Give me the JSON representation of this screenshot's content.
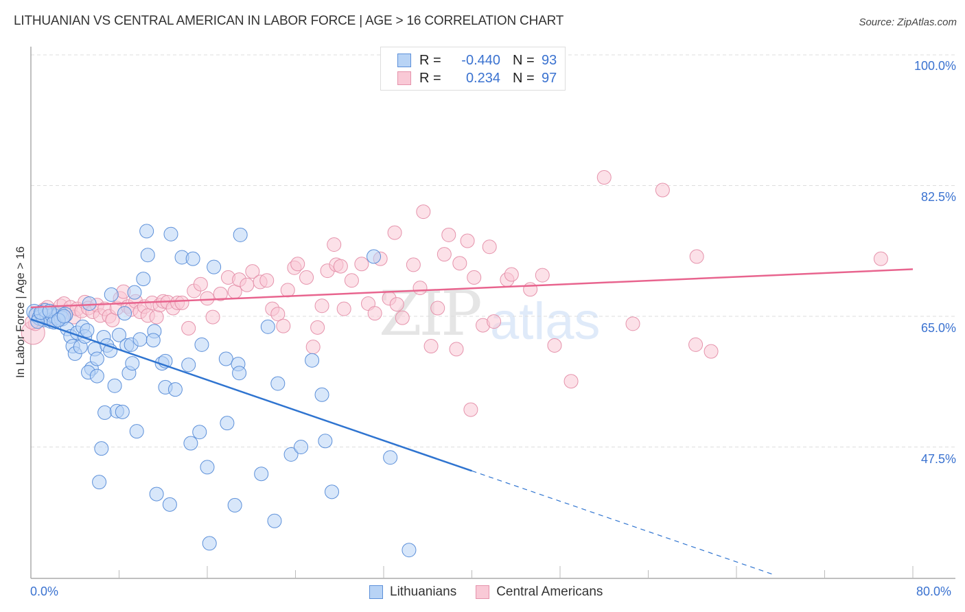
{
  "title": "LITHUANIAN VS CENTRAL AMERICAN IN LABOR FORCE | AGE > 16 CORRELATION CHART",
  "source": "Source: ZipAtlas.com",
  "watermark": {
    "zip": "ZIP",
    "atlas": "atlas"
  },
  "legend_top": {
    "rows": [
      {
        "r_label": "R =",
        "r_value": "-0.440",
        "n_label": "N =",
        "n_value": "93"
      },
      {
        "r_label": "R =",
        "r_value": "0.234",
        "n_label": "N =",
        "n_value": "97"
      }
    ]
  },
  "colors": {
    "blue_fill": "#b8d3f5",
    "blue_stroke": "#5b8fd9",
    "blue_line": "#2f74d0",
    "pink_fill": "#f9c9d6",
    "pink_stroke": "#e592ab",
    "pink_line": "#e8648e",
    "label_blue": "#3a72d0",
    "grid": "#dddddd"
  },
  "chart_data": {
    "type": "scatter",
    "title": "LITHUANIAN VS CENTRAL AMERICAN IN LABOR FORCE | AGE > 16 CORRELATION CHART",
    "xlabel": "",
    "ylabel": "In Labor Force | Age > 16",
    "xlim": [
      0,
      80
    ],
    "ylim": [
      33,
      100
    ],
    "x_tick_labels": [
      "0.0%",
      "80.0%"
    ],
    "y_ticks": [
      100.0,
      82.5,
      65.0,
      47.5
    ],
    "y_tick_labels": [
      "100.0%",
      "82.5%",
      "65.0%",
      "47.5%"
    ],
    "grid": true,
    "legend": "top-center",
    "legend_bottom": [
      "Lithuanians",
      "Central Americans"
    ],
    "series": [
      {
        "name": "Lithuanians",
        "R": -0.44,
        "N": 93,
        "trend": {
          "x0": 0,
          "y0": 64.6,
          "x1": 40,
          "y1": 44.3,
          "dashed_to_x": 67.5
        },
        "points": [
          [
            0.3,
            65.6
          ],
          [
            0.5,
            65.2
          ],
          [
            0.8,
            64.8
          ],
          [
            1.0,
            65.3
          ],
          [
            1.2,
            64.6
          ],
          [
            1.5,
            65.0
          ],
          [
            1.8,
            64.4
          ],
          [
            2.0,
            65.1
          ],
          [
            2.3,
            64.9
          ],
          [
            2.6,
            65.4
          ],
          [
            2.8,
            64.7
          ],
          [
            3.1,
            65.2
          ],
          [
            3.3,
            63.3
          ],
          [
            3.6,
            62.3
          ],
          [
            3.8,
            61.0
          ],
          [
            4.0,
            60.0
          ],
          [
            4.2,
            62.8
          ],
          [
            4.5,
            60.9
          ],
          [
            4.7,
            63.6
          ],
          [
            4.9,
            62.3
          ],
          [
            5.1,
            63.1
          ],
          [
            5.3,
            66.7
          ],
          [
            5.5,
            58.0
          ],
          [
            5.8,
            60.6
          ],
          [
            6.0,
            59.3
          ],
          [
            5.2,
            57.5
          ],
          [
            6.0,
            57.0
          ],
          [
            6.4,
            47.3
          ],
          [
            6.2,
            42.8
          ],
          [
            6.7,
            52.1
          ],
          [
            6.6,
            62.2
          ],
          [
            6.9,
            61.1
          ],
          [
            7.2,
            60.4
          ],
          [
            7.3,
            67.9
          ],
          [
            7.6,
            55.7
          ],
          [
            7.8,
            52.3
          ],
          [
            8.3,
            52.2
          ],
          [
            8.0,
            62.5
          ],
          [
            8.5,
            65.4
          ],
          [
            8.7,
            61.1
          ],
          [
            8.9,
            57.4
          ],
          [
            9.1,
            61.2
          ],
          [
            9.4,
            68.2
          ],
          [
            9.2,
            58.7
          ],
          [
            9.6,
            49.6
          ],
          [
            9.9,
            61.9
          ],
          [
            10.2,
            70.0
          ],
          [
            10.6,
            73.2
          ],
          [
            10.5,
            76.4
          ],
          [
            11.2,
            63.0
          ],
          [
            11.1,
            61.8
          ],
          [
            11.4,
            41.2
          ],
          [
            11.9,
            58.7
          ],
          [
            12.2,
            59.0
          ],
          [
            12.2,
            55.5
          ],
          [
            12.6,
            39.8
          ],
          [
            12.7,
            76.0
          ],
          [
            13.1,
            55.2
          ],
          [
            13.7,
            72.9
          ],
          [
            14.3,
            58.5
          ],
          [
            14.5,
            48.0
          ],
          [
            14.7,
            72.7
          ],
          [
            15.3,
            49.5
          ],
          [
            15.5,
            61.2
          ],
          [
            16.0,
            44.8
          ],
          [
            16.2,
            34.6
          ],
          [
            16.6,
            71.6
          ],
          [
            17.7,
            59.3
          ],
          [
            17.8,
            50.7
          ],
          [
            18.5,
            39.7
          ],
          [
            18.8,
            58.6
          ],
          [
            18.9,
            57.4
          ],
          [
            19.0,
            75.9
          ],
          [
            20.9,
            43.9
          ],
          [
            21.5,
            63.6
          ],
          [
            22.1,
            37.6
          ],
          [
            22.4,
            56.0
          ],
          [
            23.6,
            46.5
          ],
          [
            24.5,
            47.5
          ],
          [
            25.5,
            59.1
          ],
          [
            26.4,
            54.5
          ],
          [
            26.7,
            48.3
          ],
          [
            27.3,
            41.5
          ],
          [
            31.1,
            73.0
          ],
          [
            32.6,
            46.1
          ],
          [
            34.3,
            33.7
          ],
          [
            0.6,
            64.3
          ],
          [
            1.3,
            65.8
          ],
          [
            2.1,
            64.2
          ],
          [
            0.9,
            65.5
          ],
          [
            1.7,
            65.7
          ],
          [
            2.5,
            64.5
          ],
          [
            3.0,
            65.0
          ]
        ]
      },
      {
        "name": "Central Americans",
        "R": 0.234,
        "N": 97,
        "trend": {
          "x0": 0,
          "y0": 66.2,
          "x1": 80,
          "y1": 71.3
        },
        "points": [
          [
            0.2,
            62.8
          ],
          [
            0.4,
            64.0
          ],
          [
            0.6,
            65.3
          ],
          [
            0.9,
            64.6
          ],
          [
            1.2,
            65.9
          ],
          [
            1.5,
            66.2
          ],
          [
            1.8,
            64.8
          ],
          [
            2.1,
            65.6
          ],
          [
            2.4,
            65.3
          ],
          [
            2.7,
            66.4
          ],
          [
            3.0,
            66.7
          ],
          [
            3.3,
            65.6
          ],
          [
            3.6,
            66.2
          ],
          [
            3.9,
            64.9
          ],
          [
            4.2,
            66.0
          ],
          [
            4.6,
            65.7
          ],
          [
            4.9,
            66.9
          ],
          [
            5.2,
            66.1
          ],
          [
            5.6,
            65.6
          ],
          [
            6.0,
            66.5
          ],
          [
            6.3,
            65.1
          ],
          [
            6.7,
            66.0
          ],
          [
            7.1,
            65.0
          ],
          [
            7.4,
            64.5
          ],
          [
            7.8,
            66.1
          ],
          [
            8.1,
            67.4
          ],
          [
            8.4,
            68.3
          ],
          [
            8.8,
            66.3
          ],
          [
            9.1,
            65.9
          ],
          [
            9.5,
            67.0
          ],
          [
            9.9,
            65.6
          ],
          [
            10.3,
            66.3
          ],
          [
            10.6,
            65.1
          ],
          [
            11.0,
            66.8
          ],
          [
            11.4,
            64.9
          ],
          [
            11.7,
            66.5
          ],
          [
            12.0,
            67.0
          ],
          [
            12.4,
            66.9
          ],
          [
            12.9,
            66.1
          ],
          [
            13.3,
            66.8
          ],
          [
            13.7,
            66.8
          ],
          [
            14.3,
            63.4
          ],
          [
            14.8,
            68.4
          ],
          [
            15.4,
            69.3
          ],
          [
            16.0,
            67.4
          ],
          [
            16.5,
            64.9
          ],
          [
            17.2,
            68.0
          ],
          [
            17.9,
            70.2
          ],
          [
            18.5,
            68.3
          ],
          [
            18.9,
            69.9
          ],
          [
            19.6,
            69.2
          ],
          [
            20.1,
            71.0
          ],
          [
            20.8,
            69.6
          ],
          [
            21.4,
            69.8
          ],
          [
            21.9,
            66.0
          ],
          [
            22.4,
            65.3
          ],
          [
            22.9,
            63.7
          ],
          [
            23.3,
            68.5
          ],
          [
            23.9,
            71.5
          ],
          [
            24.2,
            72.0
          ],
          [
            25.0,
            70.2
          ],
          [
            25.6,
            60.9
          ],
          [
            26.0,
            63.5
          ],
          [
            26.4,
            66.4
          ],
          [
            26.9,
            71.1
          ],
          [
            27.5,
            74.6
          ],
          [
            27.7,
            71.9
          ],
          [
            28.1,
            71.7
          ],
          [
            28.4,
            66.0
          ],
          [
            29.1,
            69.8
          ],
          [
            30.0,
            72.0
          ],
          [
            30.6,
            66.7
          ],
          [
            31.2,
            65.4
          ],
          [
            31.7,
            72.7
          ],
          [
            32.5,
            67.4
          ],
          [
            33.0,
            76.2
          ],
          [
            33.2,
            66.6
          ],
          [
            33.7,
            64.8
          ],
          [
            34.7,
            71.9
          ],
          [
            35.3,
            68.8
          ],
          [
            35.6,
            79.0
          ],
          [
            36.3,
            61.0
          ],
          [
            36.9,
            66.1
          ],
          [
            37.5,
            73.3
          ],
          [
            37.9,
            75.9
          ],
          [
            38.6,
            60.6
          ],
          [
            38.9,
            72.1
          ],
          [
            39.6,
            75.1
          ],
          [
            39.9,
            52.5
          ],
          [
            40.2,
            70.2
          ],
          [
            41.0,
            63.8
          ],
          [
            41.6,
            74.3
          ],
          [
            42.0,
            64.3
          ],
          [
            43.2,
            69.9
          ],
          [
            43.6,
            70.6
          ],
          [
            45.3,
            68.6
          ],
          [
            46.4,
            70.5
          ],
          [
            47.5,
            61.1
          ],
          [
            49.0,
            56.3
          ],
          [
            52.0,
            83.6
          ],
          [
            54.6,
            64.0
          ],
          [
            57.3,
            81.9
          ],
          [
            60.3,
            61.2
          ],
          [
            60.4,
            73.0
          ],
          [
            61.7,
            60.3
          ],
          [
            77.1,
            72.7
          ],
          [
            0.1,
            64.2
          ]
        ]
      }
    ]
  }
}
